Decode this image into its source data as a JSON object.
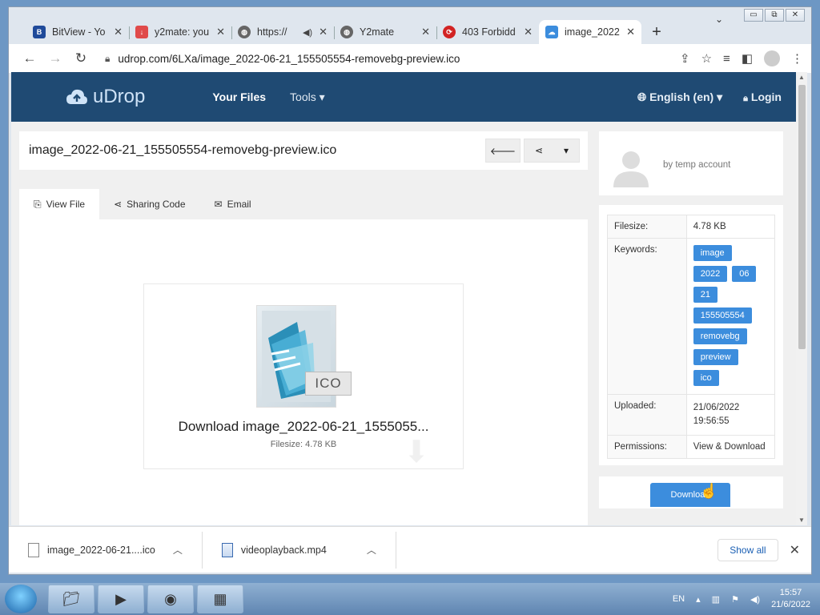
{
  "window": {
    "minimize": "▭",
    "restore": "⧉",
    "close": "✕"
  },
  "browser": {
    "tabs": [
      {
        "title": "BitView - Yo",
        "icon": "bitview-icon",
        "color": "#1f4a9a",
        "active": false
      },
      {
        "title": "y2mate: you",
        "icon": "y2mate-icon",
        "color": "#e04a4a",
        "active": false
      },
      {
        "title": "https://",
        "icon": "globe-icon",
        "color": "#666666",
        "active": false,
        "audio": true
      },
      {
        "title": "Y2mate",
        "icon": "globe-icon",
        "color": "#666666",
        "active": false
      },
      {
        "title": "403 Forbidd",
        "icon": "forbidden-icon",
        "color": "#d22323",
        "active": false
      },
      {
        "title": "image_2022",
        "icon": "udrop-cloud-icon",
        "color": "#3c8ddd",
        "active": true
      }
    ],
    "url": "udrop.com/6LXa/image_2022-06-21_155505554-removebg-preview.ico"
  },
  "site": {
    "logo": "uDrop",
    "nav": {
      "your_files": "Your Files",
      "tools": "Tools"
    },
    "language": "English (en)",
    "login": "Login"
  },
  "file": {
    "name": "image_2022-06-21_155505554-removebg-preview.ico",
    "tabs": {
      "view": "View File",
      "sharing": "Sharing Code",
      "email": "Email"
    },
    "badge": "ICO",
    "download_title": "Download image_2022-06-21_1555055...",
    "download_size": "Filesize: 4.78 KB",
    "owner": "by temp account",
    "info": {
      "filesize_label": "Filesize:",
      "filesize": "4.78 KB",
      "keywords_label": "Keywords:",
      "keywords": [
        "image",
        "2022",
        "06",
        "21",
        "155505554",
        "removebg",
        "preview",
        "ico"
      ],
      "uploaded_label": "Uploaded:",
      "uploaded": "21/06/2022 19:56:55",
      "permissions_label": "Permissions:",
      "permissions": "View & Download"
    },
    "download_button": "Download"
  },
  "downloads": {
    "items": [
      "image_2022-06-21....ico",
      "videoplayback.mp4"
    ],
    "show_all": "Show all"
  },
  "taskbar": {
    "lang": "EN",
    "time": "15:57",
    "date": "21/6/2022"
  }
}
